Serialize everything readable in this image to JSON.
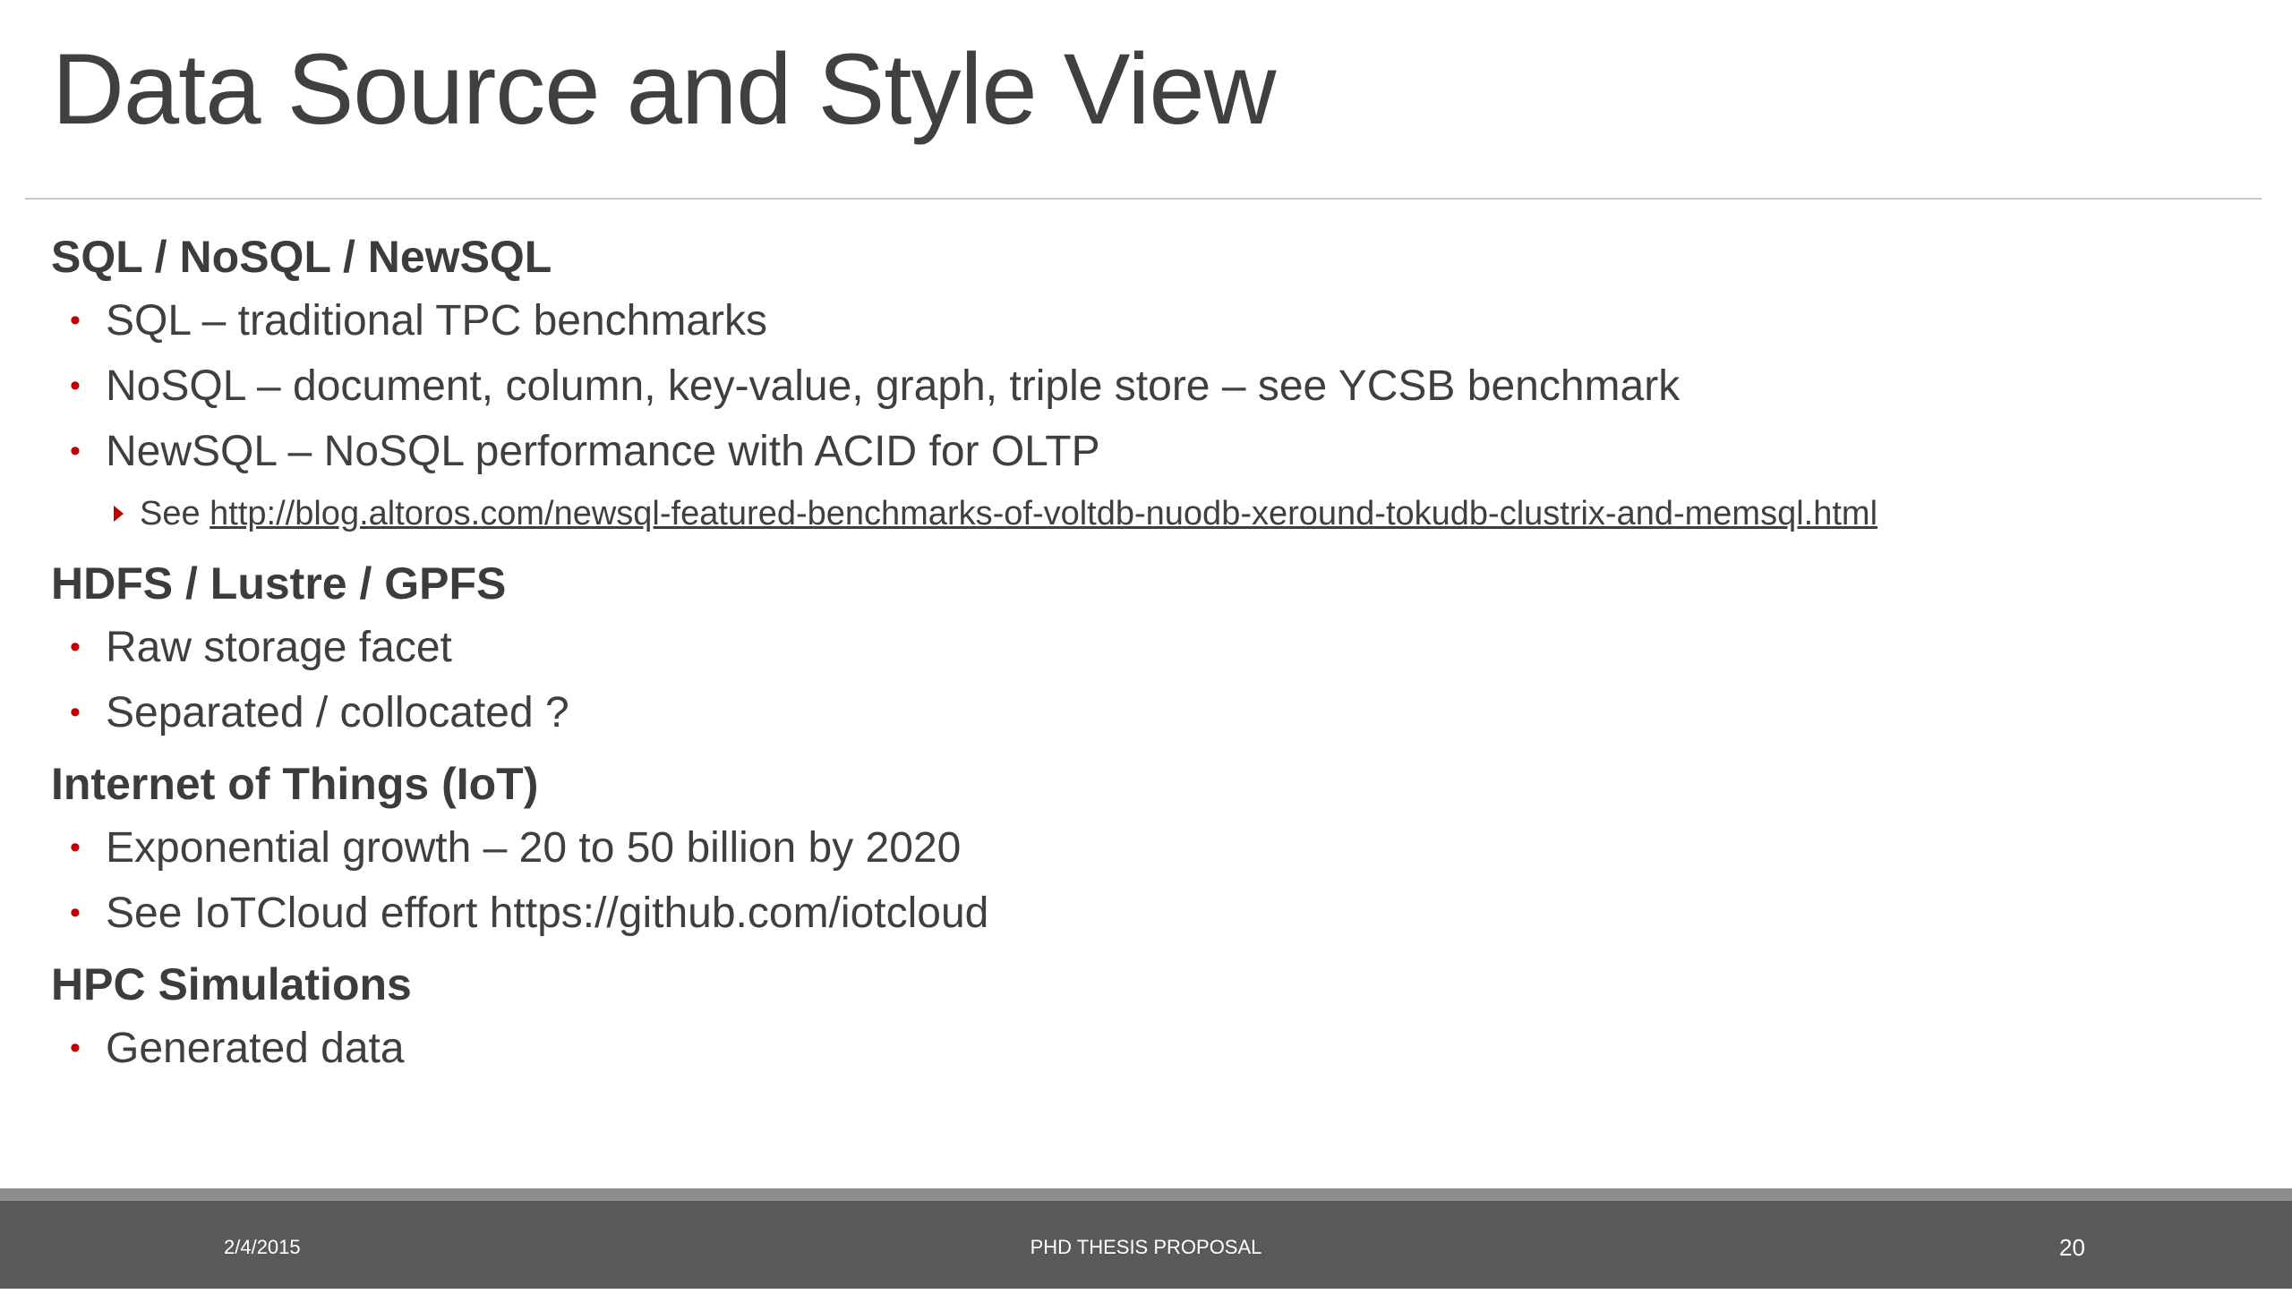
{
  "slide": {
    "title": "Data Source and Style View",
    "sections": [
      {
        "heading": "SQL / NoSQL / NewSQL",
        "bullets": [
          "SQL – traditional TPC benchmarks",
          "NoSQL – document, column, key-value, graph, triple store – see YCSB benchmark",
          "NewSQL – NoSQL performance with ACID for OLTP"
        ],
        "sub": {
          "prefix": "See ",
          "link": "http://blog.altoros.com/newsql-featured-benchmarks-of-voltdb-nuodb-xeround-tokudb-clustrix-and-memsql.html"
        }
      },
      {
        "heading": "HDFS / Lustre / GPFS",
        "bullets": [
          "Raw storage facet",
          "Separated / collocated ?"
        ]
      },
      {
        "heading": "Internet of Things (IoT)",
        "bullets": [
          "Exponential growth – 20 to 50 billion by 2020",
          "See IoTCloud effort https://github.com/iotcloud"
        ]
      },
      {
        "heading": "HPC Simulations",
        "bullets": [
          "Generated data"
        ]
      }
    ]
  },
  "footer": {
    "date": "2/4/2015",
    "center": "PHD THESIS PROPOSAL",
    "page": "20"
  },
  "colors": {
    "bullet_accent": "#c00000",
    "footer_bar": "#595959",
    "footer_strip": "#8c8c8c"
  },
  "icons": {
    "bullet": "red-dot-bullet",
    "sub_bullet": "red-triangle-bullet"
  }
}
